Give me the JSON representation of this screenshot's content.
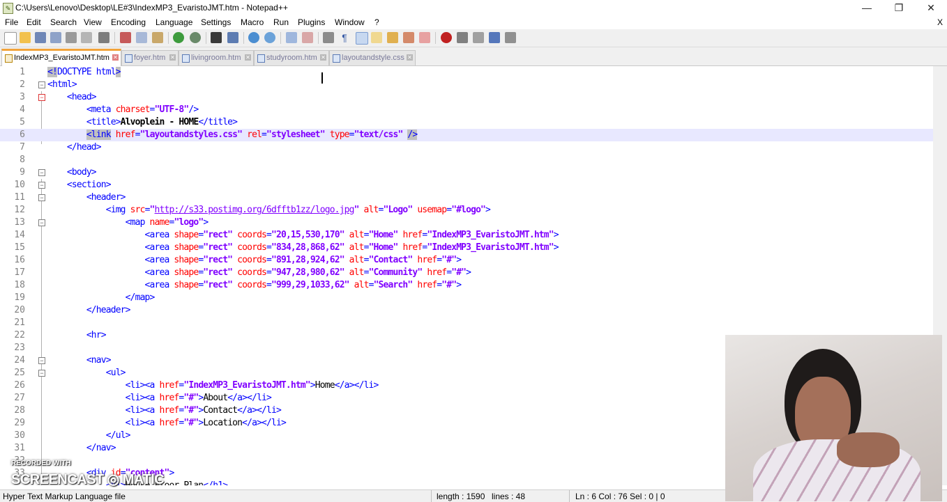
{
  "window": {
    "title": "C:\\Users\\Lenovo\\Desktop\\LE#3\\IndexMP3_EvaristoJMT.htm - Notepad++",
    "minimize": "—",
    "restore": "❐",
    "close": "✕"
  },
  "menu": {
    "items": [
      "File",
      "Edit",
      "Search",
      "View",
      "Encoding",
      "Language",
      "Settings",
      "Macro",
      "Run",
      "Plugins",
      "Window",
      "?"
    ],
    "close_doc": "X"
  },
  "tabs": [
    {
      "label": "IndexMP3_EvaristoJMT.htm",
      "active": true
    },
    {
      "label": "foyer.htm",
      "active": false
    },
    {
      "label": "livingroom.htm",
      "active": false
    },
    {
      "label": "studyroom.htm",
      "active": false
    },
    {
      "label": "layoutandstyle.css",
      "active": false
    }
  ],
  "editor": {
    "current_line": 6,
    "lines": [
      {
        "n": "1"
      },
      {
        "n": "2"
      },
      {
        "n": "3"
      },
      {
        "n": "4"
      },
      {
        "n": "5"
      },
      {
        "n": "6"
      },
      {
        "n": "7"
      },
      {
        "n": "8"
      },
      {
        "n": "9"
      },
      {
        "n": "10"
      },
      {
        "n": "11"
      },
      {
        "n": "12"
      },
      {
        "n": "13"
      },
      {
        "n": "14"
      },
      {
        "n": "15"
      },
      {
        "n": "16"
      },
      {
        "n": "17"
      },
      {
        "n": "18"
      },
      {
        "n": "19"
      },
      {
        "n": "20"
      },
      {
        "n": "21"
      },
      {
        "n": "22"
      },
      {
        "n": "23"
      },
      {
        "n": "24"
      },
      {
        "n": "25"
      },
      {
        "n": "26"
      },
      {
        "n": "27"
      },
      {
        "n": "28"
      },
      {
        "n": "29"
      },
      {
        "n": "30"
      },
      {
        "n": "31"
      },
      {
        "n": "32"
      },
      {
        "n": "33"
      }
    ]
  },
  "status": {
    "file_type": "Hyper Text Markup Language file",
    "length": "length : 1590",
    "lines": "lines : 48",
    "position": "Ln : 6    Col : 76    Sel : 0 | 0"
  },
  "watermark": {
    "line1": "RECORDED WITH",
    "line2": "SCREENCAST",
    "line3": "MATIC"
  }
}
